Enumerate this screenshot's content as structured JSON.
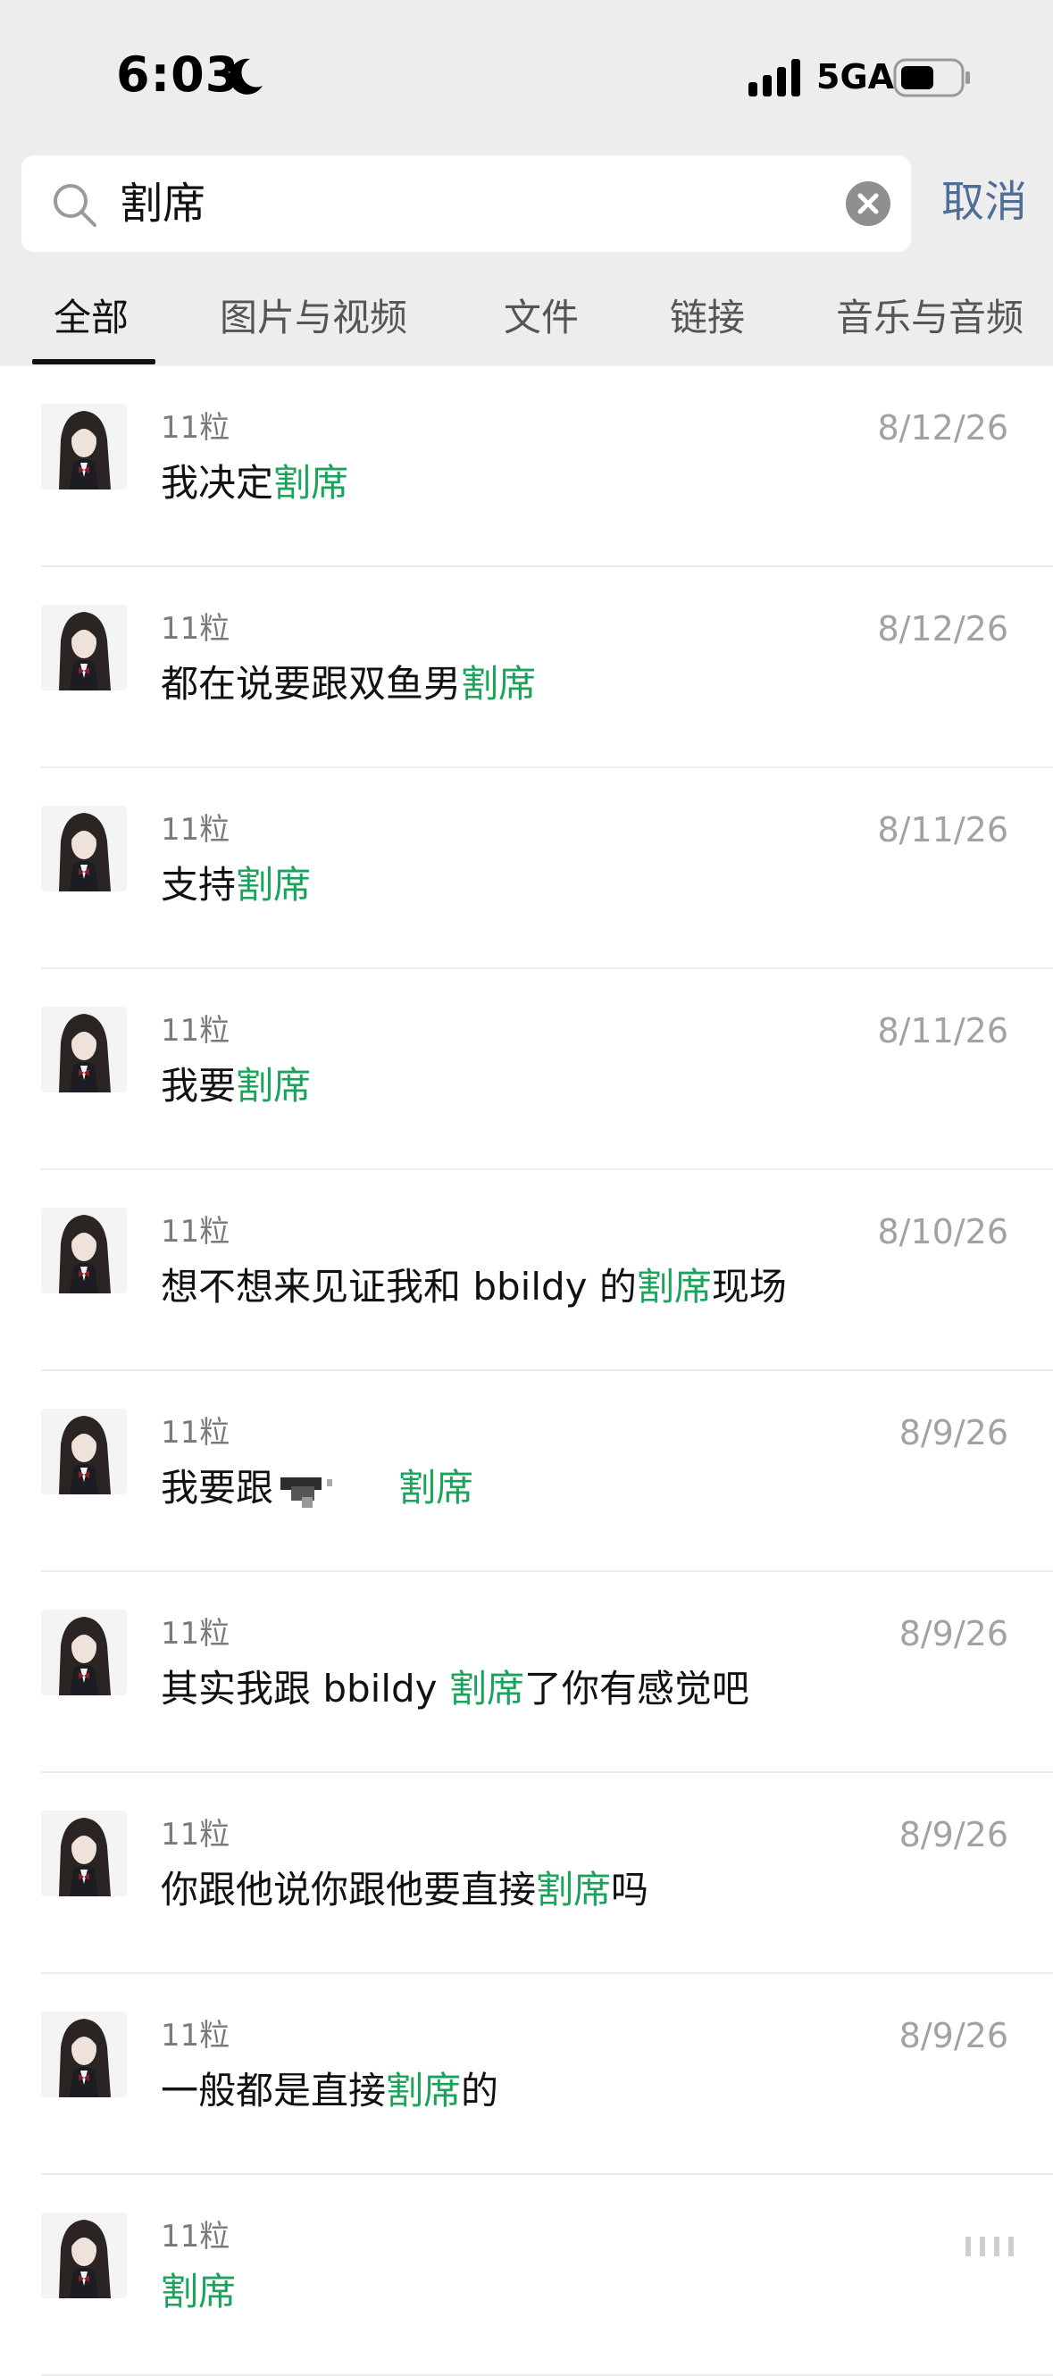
{
  "status_bar": {
    "time": "6:03",
    "network": "5GA",
    "icons": [
      "moon-icon",
      "signal-icon",
      "battery-icon"
    ]
  },
  "search": {
    "query": "割席",
    "cancel_label": "取消",
    "icons": [
      "search-icon",
      "clear-icon"
    ]
  },
  "tabs": [
    {
      "label": "全部",
      "active": true
    },
    {
      "label": "图片与视频",
      "active": false
    },
    {
      "label": "文件",
      "active": false
    },
    {
      "label": "链接",
      "active": false
    },
    {
      "label": "音乐与音频",
      "active": false
    }
  ],
  "colors": {
    "highlight": "#1aa35a",
    "link": "#4e6e95",
    "header_bg": "#ededed"
  },
  "results": [
    {
      "sender": "11粒",
      "date": "8/12/26",
      "before": "我决定",
      "keyword": "割席",
      "after": ""
    },
    {
      "sender": "11粒",
      "date": "8/12/26",
      "before": "都在说要跟双鱼男",
      "keyword": "割席",
      "after": ""
    },
    {
      "sender": "11粒",
      "date": "8/11/26",
      "before": "支持",
      "keyword": "割席",
      "after": ""
    },
    {
      "sender": "11粒",
      "date": "8/11/26",
      "before": "我要",
      "keyword": "割席",
      "after": ""
    },
    {
      "sender": "11粒",
      "date": "8/10/26",
      "before": "想不想来见证我和 bbildy 的",
      "keyword": "割席",
      "after": "现场"
    },
    {
      "sender": "11粒",
      "date": "8/9/26",
      "before": "我要跟",
      "keyword": "割席",
      "after": "",
      "redacted": true
    },
    {
      "sender": "11粒",
      "date": "8/9/26",
      "before": "其实我跟 bbildy ",
      "keyword": "割席",
      "after": "了你有感觉吧"
    },
    {
      "sender": "11粒",
      "date": "8/9/26",
      "before": "你跟他说你跟他要直接",
      "keyword": "割席",
      "after": "吗"
    },
    {
      "sender": "11粒",
      "date": "8/9/26",
      "before": "一般都是直接",
      "keyword": "割席",
      "after": "的"
    },
    {
      "sender": "11粒",
      "date": "",
      "before": "",
      "keyword": "割席",
      "after": ""
    }
  ]
}
